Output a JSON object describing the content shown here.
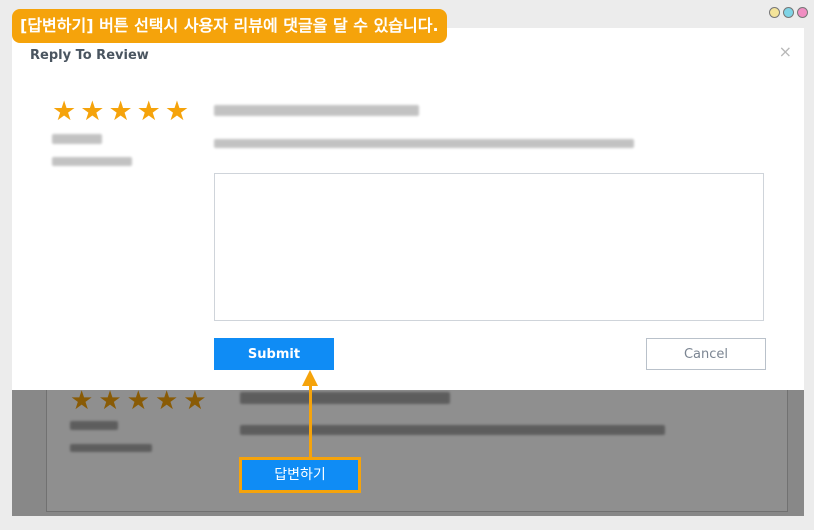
{
  "caption": "[답변하기] 버튼 선택시 사용자 리뷰에 댓글을 달 수 있습니다.",
  "window_dots": [
    "#f4e49a",
    "#7fd4e6",
    "#f08ec2"
  ],
  "modal": {
    "title": "Reply To Review",
    "close": "×",
    "rating": 5,
    "reply_placeholder": "",
    "submit_label": "Submit",
    "cancel_label": "Cancel"
  },
  "background_review": {
    "rating": 5
  },
  "callout_label": "답변하기",
  "colors": {
    "accent": "#f5a30b",
    "primary": "#0f8cf5"
  }
}
